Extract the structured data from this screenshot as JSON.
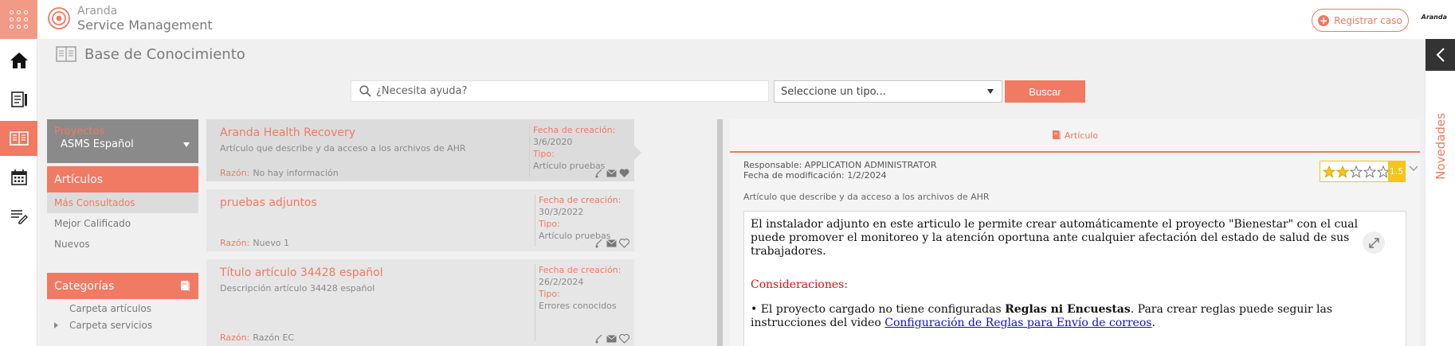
{
  "app": {
    "brand_line1": "Aranda",
    "brand_line2": "Service Management",
    "register_label": "Registrar caso",
    "corner_logo": "Aranda"
  },
  "page": {
    "title": "Base de Conocimiento"
  },
  "search": {
    "placeholder": "¿Necesita ayuda?",
    "type_select": "Seleccione un tipo...",
    "button": "Buscar"
  },
  "nav": {
    "projects_label": "Proyectos",
    "project_value": "ASMS Español",
    "articles_label": "Artículos",
    "article_items": [
      "Más Consultados",
      "Mejor Calificado",
      "Nuevos"
    ],
    "categories_label": "Categorías",
    "category_items": [
      "Carpeta artículos",
      "Carpeta servicios"
    ]
  },
  "articles": [
    {
      "title": "Aranda Health Recovery",
      "description": "Artículo que describe y da acceso a los archivos de AHR",
      "reason_label": "Razón:",
      "reason": "No hay información",
      "created_label": "Fecha de creación:",
      "created": "3/6/2020",
      "type_label": "Tipo:",
      "type": "Artículo pruebas"
    },
    {
      "title": "pruebas adjuntos",
      "description": "",
      "reason_label": "Razón:",
      "reason": "Nuevo 1",
      "created_label": "Fecha de creación:",
      "created": "30/3/2022",
      "type_label": "Tipo:",
      "type": "Artículo pruebas"
    },
    {
      "title": "Título artículo 34428 español",
      "description": "Descripción artículo 34428 español",
      "reason_label": "Razón:",
      "reason": "Razón EC",
      "created_label": "Fecha de creación:",
      "created": "26/2/2024",
      "type_label": "Tipo:",
      "type": "Errores conocidos"
    }
  ],
  "detail": {
    "tab_label": "Artículo",
    "responsible": "Responsable: APPLICATION ADMINISTRATOR",
    "modified": "Fecha de modificación: 1/2/2024",
    "rating_value": 1.5,
    "rating_text": "1.5",
    "rating_max": 5,
    "description": "Artículo que describe y da acceso a los archivos de AHR",
    "body_p1": "El instalador adjunto en este articulo le permite crear automáticamente el proyecto \"Bienestar\" con el cual puede promover el monitoreo y la atención oportuna ante cualquier afectación del estado de salud de sus trabajadores.",
    "considerations": "Consideraciones:",
    "bullet_start": "• El proyecto cargado no tiene configuradas ",
    "bullet_bold": "Reglas ni Encuestas",
    "bullet_mid": ". Para crear reglas puede seguir las instrucciones del video ",
    "bullet_link": "Configuración de Reglas para Envío de correos",
    "bullet_end": "."
  },
  "side": {
    "news_label": "Novedades"
  },
  "colors": {
    "accent": "#f07a62",
    "star": "#f5c518",
    "panel": "#8a8a8a"
  }
}
